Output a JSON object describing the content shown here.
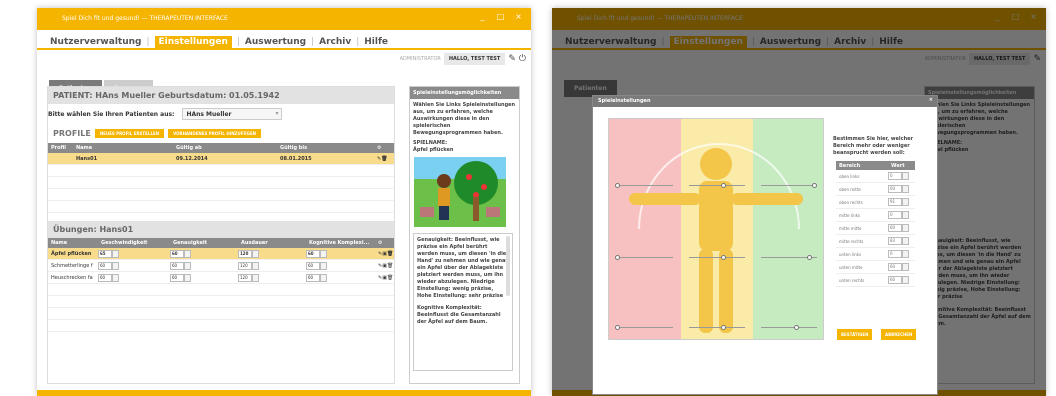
{
  "app": {
    "title": "Spiel Dich fit und gesund! — THERAPEUTEN INTERFACE",
    "win_min": "_",
    "win_max": "□",
    "win_close": "×"
  },
  "nav": {
    "items": [
      "Nutzerverwaltung",
      "Einstellungen",
      "Auswertung",
      "Archiv",
      "Hilfe"
    ],
    "active": 1
  },
  "userbar": {
    "role": "ADMINISTRATOR",
    "greeting": "HALLO, TEST TEST",
    "edit_icon": "pencil-icon",
    "power_icon": "power-icon"
  },
  "tabs": [
    "Patienten",
    "Gruppen"
  ],
  "patient": {
    "header": "PATIENT: HAns Mueller  Geburtsdatum: 01.05.1942",
    "select_label": "Bitte wählen Sie Ihren Patienten aus:",
    "select_value": "HAns Mueller"
  },
  "profile": {
    "title": "PROFILE",
    "btn_new": "NEUES PROFIL ERSTELLEN",
    "btn_existing": "VORHANDENES PROFIL HINZUFÜGEN",
    "columns": [
      "Profil",
      "Name",
      "Gültig ab",
      "Gültig bis"
    ],
    "rows": [
      {
        "name": "Hans01",
        "from": "09.12.2014",
        "to": "08.01.2015"
      }
    ]
  },
  "exercises": {
    "title": "Übungen: Hans01",
    "columns": [
      "Name",
      "Geschwindigkeit",
      "Genauigkeit",
      "Ausdauer",
      "Kognitive Komplexi..."
    ],
    "rows": [
      {
        "name": "Äpfel pflücken",
        "v1": "65",
        "v2": "60",
        "v3": "120",
        "v4": "60"
      },
      {
        "name": "Schmetterlinge f",
        "v1": "60",
        "v2": "60",
        "v3": "120",
        "v4": "60"
      },
      {
        "name": "Heuschrecken fa",
        "v1": "60",
        "v2": "60",
        "v3": "120",
        "v4": "60"
      }
    ]
  },
  "right_panel": {
    "header": "Spieleinstellungsmöglichkeiten",
    "intro": "Wählen Sie Links Spieleinstellungen aus, um zu erfahren, welche Auswirkungen diese in den spielerischen Bewegungsprogrammen haben.",
    "game_label": "SPIELNAME:",
    "game_name": "Äpfel pflücken",
    "desc": "Genauigkeit: Beeinflusst, wie präzise ein Apfel berührt werden muss, um diesen 'in die Hand' zu nehmen und wie genau ein Apfel über der Ablagekiste platziert werden muss, um ihn wieder abzulegen. Niedrige Einstellung: wenig präzise, Hohe Einstellung: sehr präzise",
    "desc2": "Kognitive Komplexität: Beeinflusst die Gesamtanzahl der Äpfel auf dem Baum."
  },
  "dialog": {
    "title": "Spieleinstellungen",
    "close": "×",
    "text": "Bestimmen Sie hier, welcher Bereich mehr oder weniger beansprucht werden soll:",
    "columns": [
      "Bereich",
      "Wert"
    ],
    "rows": [
      [
        "oben links",
        "0"
      ],
      [
        "oben mitte",
        "60"
      ],
      [
        "oben rechts",
        "91"
      ],
      [
        "mitte links",
        "0"
      ],
      [
        "mitte mitte",
        "60"
      ],
      [
        "mitte rechts",
        "83"
      ],
      [
        "unten links",
        "0"
      ],
      [
        "unten mitte",
        "60"
      ],
      [
        "unten rechts",
        "60"
      ]
    ],
    "confirm": "BESTÄTIGEN",
    "cancel": "ABBRECHEN"
  },
  "colors": {
    "accent": "#f5b400",
    "red_zone": "#f4a0a0",
    "yellow_zone": "#f8e27a",
    "green_zone": "#a8e0a0"
  }
}
